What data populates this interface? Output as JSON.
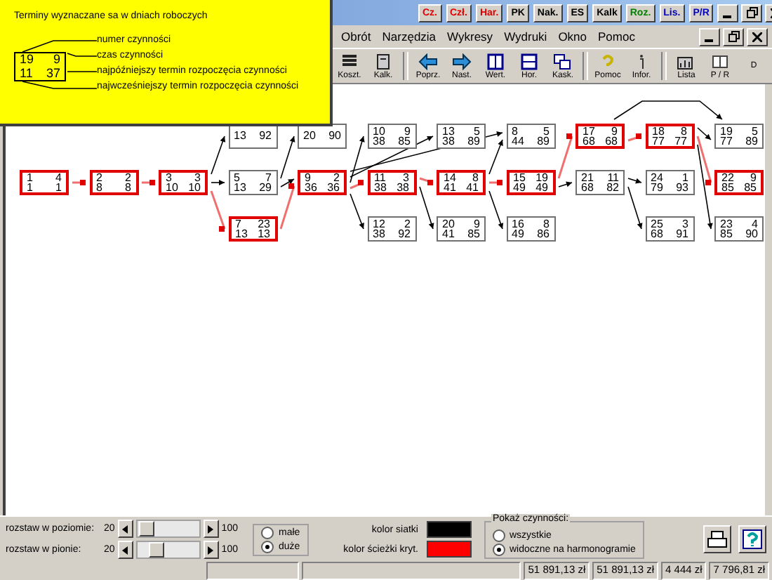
{
  "legend": {
    "title": "Terminy wyznaczane sa w dniach roboczych",
    "sample": {
      "num": "19",
      "dur": "9",
      "es": "11",
      "ls": "37"
    },
    "labels": [
      "numer czynności",
      "czas  czynności",
      "najpóźniejszy termin rozpoczęcia czynności",
      "najwcześniejszy termin rozpoczęcia czynności"
    ]
  },
  "title_bar": {
    "modules": [
      {
        "label": "Cz.",
        "color": "#e00000"
      },
      {
        "label": "Czł.",
        "color": "#e00000"
      },
      {
        "label": "Har.",
        "color": "#e00000"
      },
      {
        "label": "PK",
        "color": "#000000"
      },
      {
        "label": "Nak.",
        "color": "#000000"
      },
      {
        "label": "ES",
        "color": "#000000"
      },
      {
        "label": "Kalk",
        "color": "#000000"
      },
      {
        "label": "Roz.",
        "color": "#008000"
      },
      {
        "label": "Lis.",
        "color": "#0000c0"
      },
      {
        "label": "P/R",
        "color": "#0000c0"
      }
    ]
  },
  "menu": [
    "Obrót",
    "Narzędzia",
    "Wykresy",
    "Wydruki",
    "Okno",
    "Pomoc"
  ],
  "toolbar": [
    {
      "label": "Koszt.",
      "kind": "list"
    },
    {
      "label": "Kalk.",
      "kind": "calc"
    },
    {
      "label": "Poprz.",
      "kind": "prev"
    },
    {
      "label": "Nast.",
      "kind": "next"
    },
    {
      "label": "Wert.",
      "kind": "vert"
    },
    {
      "label": "Hor.",
      "kind": "hor"
    },
    {
      "label": "Kask.",
      "kind": "cascade"
    },
    {
      "label": "Pomoc",
      "kind": "help"
    },
    {
      "label": "Infor.",
      "kind": "info"
    },
    {
      "label": "Lista",
      "kind": "chart"
    },
    {
      "label": "P / R",
      "kind": "book"
    },
    {
      "label": "D",
      "kind": "cut"
    }
  ],
  "nodes": [
    {
      "es": "13",
      "ls": "92",
      "critical": false
    },
    {
      "es": "20",
      "ls": "90",
      "critical": false
    },
    {
      "num": "10",
      "dur": "9",
      "es": "38",
      "ls": "85",
      "critical": false
    },
    {
      "num": "13",
      "dur": "5",
      "es": "38",
      "ls": "89",
      "critical": false
    },
    {
      "num": "8",
      "dur": "5",
      "es": "44",
      "ls": "89",
      "critical": false
    },
    {
      "num": "17",
      "dur": "9",
      "es": "68",
      "ls": "68",
      "critical": true
    },
    {
      "num": "18",
      "dur": "8",
      "es": "77",
      "ls": "77",
      "critical": true
    },
    {
      "num": "19",
      "dur": "5",
      "es": "77",
      "ls": "89",
      "critical": false
    },
    {
      "num": "1",
      "dur": "4",
      "es": "1",
      "ls": "1",
      "critical": true
    },
    {
      "num": "2",
      "dur": "2",
      "es": "8",
      "ls": "8",
      "critical": true
    },
    {
      "num": "3",
      "dur": "3",
      "es": "10",
      "ls": "10",
      "critical": true
    },
    {
      "num": "5",
      "dur": "7",
      "es": "13",
      "ls": "29",
      "critical": false
    },
    {
      "num": "9",
      "dur": "2",
      "es": "36",
      "ls": "36",
      "critical": true
    },
    {
      "num": "11",
      "dur": "3",
      "es": "38",
      "ls": "38",
      "critical": true
    },
    {
      "num": "14",
      "dur": "8",
      "es": "41",
      "ls": "41",
      "critical": true
    },
    {
      "num": "15",
      "dur": "19",
      "es": "49",
      "ls": "49",
      "critical": true
    },
    {
      "num": "21",
      "dur": "11",
      "es": "68",
      "ls": "82",
      "critical": false
    },
    {
      "num": "24",
      "dur": "1",
      "es": "79",
      "ls": "93",
      "critical": false
    },
    {
      "num": "22",
      "dur": "9",
      "es": "85",
      "ls": "85",
      "critical": true
    },
    {
      "num": "7",
      "dur": "23",
      "es": "13",
      "ls": "13",
      "critical": true
    },
    {
      "num": "12",
      "dur": "2",
      "es": "38",
      "ls": "92",
      "critical": false
    },
    {
      "num": "20",
      "dur": "9",
      "es": "41",
      "ls": "85",
      "critical": false
    },
    {
      "num": "16",
      "dur": "8",
      "es": "49",
      "ls": "86",
      "critical": false
    },
    {
      "num": "25",
      "dur": "3",
      "es": "68",
      "ls": "91",
      "critical": false
    },
    {
      "num": "23",
      "dur": "4",
      "es": "85",
      "ls": "90",
      "critical": false
    }
  ],
  "spacing": [
    {
      "label": "rozstaw w poziomie:",
      "min": "20",
      "max": "100",
      "level": 0.05
    },
    {
      "label": "rozstaw w pionie:",
      "min": "20",
      "max": "100",
      "level": 0.25
    }
  ],
  "size_options": [
    {
      "label": "małe",
      "selected": false
    },
    {
      "label": "duże",
      "selected": true
    }
  ],
  "colors": [
    {
      "label": "kolor siatki",
      "color": "#000000"
    },
    {
      "label": "kolor ścieżki kryt.",
      "color": "#ff0000"
    }
  ],
  "show_group": {
    "title": "Pokaż czynności:",
    "options": [
      {
        "label": "wszystkie",
        "selected": false
      },
      {
        "label": "widoczne na harmonogramie",
        "selected": true
      }
    ]
  },
  "status_bar": [
    "51 891,13 zł",
    "51 891,13 zł",
    "4 444 zł",
    "7 796,81 zł"
  ]
}
